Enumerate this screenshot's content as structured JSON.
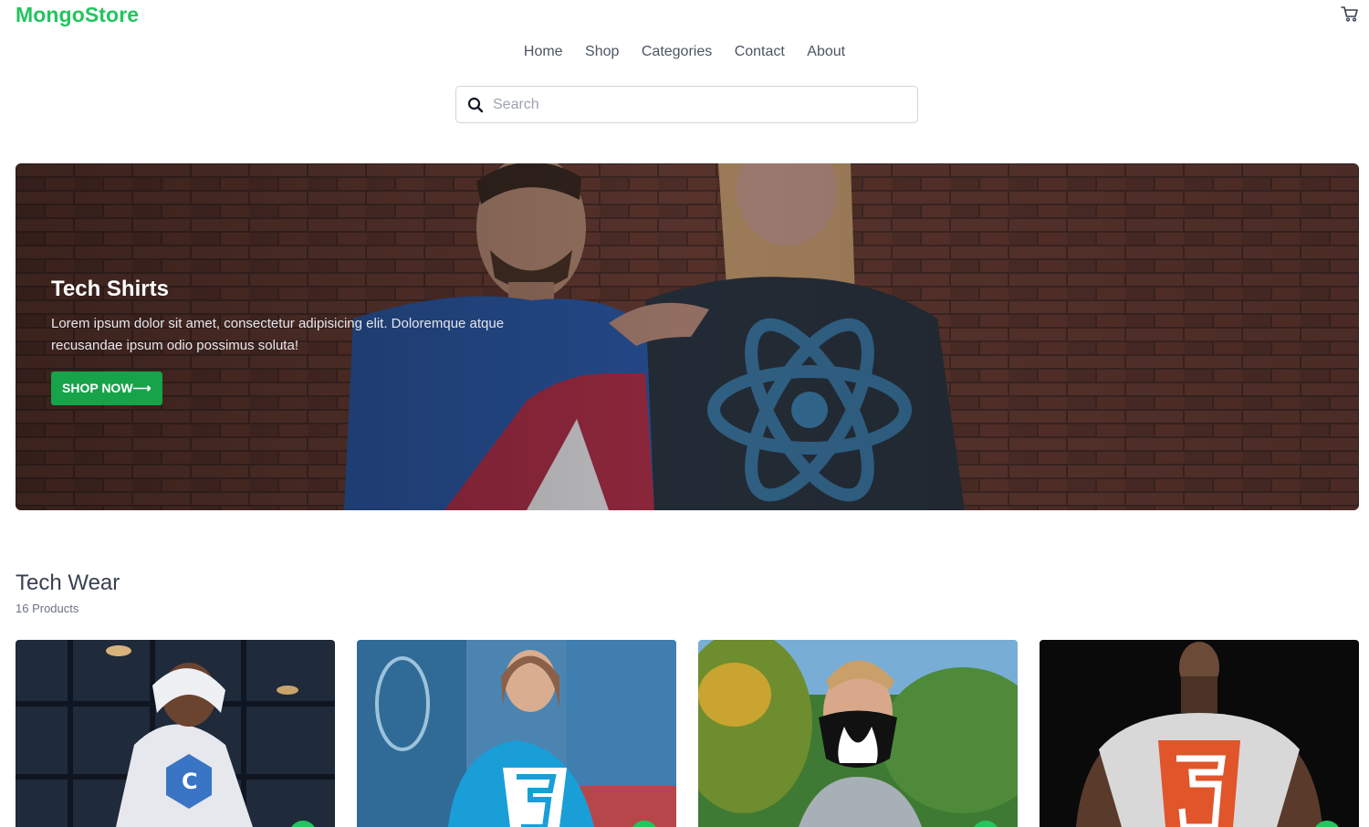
{
  "header": {
    "logo": "MongoStore",
    "cart_icon": "cart-icon"
  },
  "nav": {
    "items": [
      "Home",
      "Shop",
      "Categories",
      "Contact",
      "About"
    ]
  },
  "search": {
    "placeholder": "Search",
    "value": "",
    "icon": "search-icon"
  },
  "hero": {
    "title": "Tech Shirts",
    "text": "Lorem ipsum dolor sit amet, consectetur adipisicing elit. Doloremque atque recusandae ipsum odio possimus soluta!",
    "button": "SHOP NOW⟶"
  },
  "section": {
    "title": "Tech Wear",
    "count": "16 Products"
  },
  "colors": {
    "brand": "#22c55e",
    "button": "#16a34a"
  }
}
